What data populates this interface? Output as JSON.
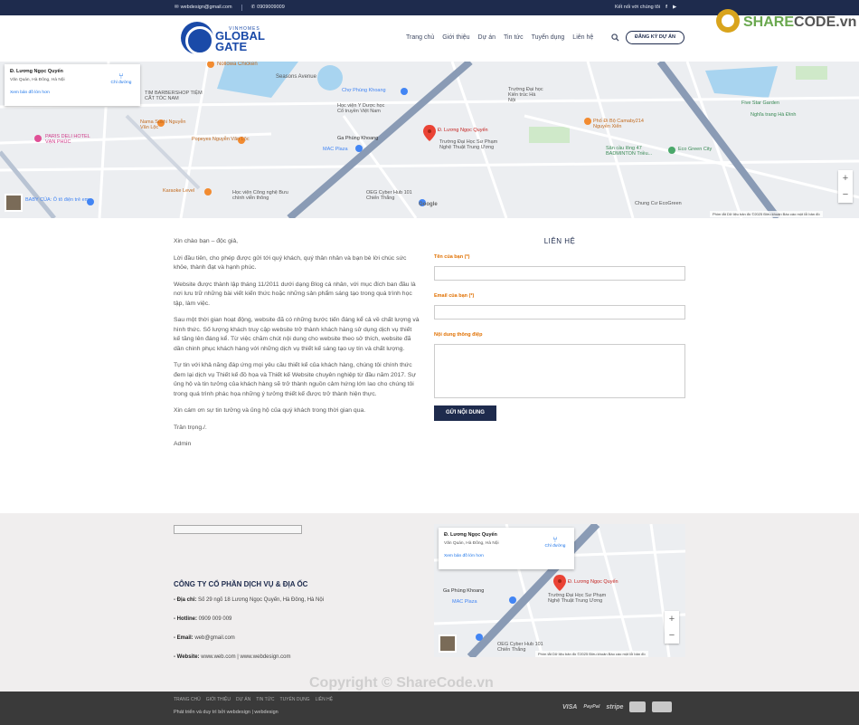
{
  "topbar": {
    "email": "webdesign@gmail.com",
    "phone": "0909009009",
    "social_label": "Kết nối với chúng tôi"
  },
  "logo": {
    "small": "VINHOMES",
    "line1": "GLOBAL",
    "line2": "GATE"
  },
  "nav": {
    "items": [
      "Trang chủ",
      "Giới thiệu",
      "Dự án",
      "Tin tức",
      "Tuyển dụng",
      "Liên hệ"
    ],
    "register_label": "ĐĂNG KÝ DỰ ÁN"
  },
  "map": {
    "place_name": "Đ. Lương Ngọc Quyến",
    "address": "Văn Quán, Hà Đông, Hà Nội",
    "directions": "Chỉ đường",
    "larger_map": "Xem bản đồ lớn hơn",
    "pin_label": "Đ. Lương Ngọc Quyến",
    "zoom_in": "+",
    "zoom_out": "−",
    "footer": "Phím tắt   Dữ liệu bản đồ ©2025   Điều khoản   Báo cáo một lỗi bản đồ",
    "labels": {
      "nollowa": "Nollowa Chicken",
      "seasons": "Seasons Avenue",
      "barber": "TIM BARBERSHOP TIỆM CẮT TÓC NAM",
      "chophung": "Chợ Phùng Khoang",
      "hocvien": "Học viện Y Dược học Cổ truyền Việt Nam",
      "truongdh": "Trường Đại học Kiến trúc Hà Nội",
      "namasushi": "Nama Sushi Nguyễn Văn Lộc",
      "paris": "PARIS DELI HOTEL VẠN PHÚC",
      "popeyes": "Popeyes Nguyễn Văn Lộc",
      "gaphung": "Ga Phùng Khoang",
      "macplaza": "MAC Plaza",
      "spkt": "Trường Đại Học Sư Phạm Nghệ Thuật Trung Ương",
      "pho": "Phố Đi Bộ Camaby214 Nguyễn Xiển",
      "sanbadminton": "Sân cầu lông 47 BADMINTON Triều...",
      "ecogreen": "Eco Green City",
      "fivestar": "Five Star Garden",
      "nghiatrang": "Nghĩa trang Hà Đình",
      "karaoke": "Karaoke Level",
      "hvcn": "Học viện Công nghệ Bưu chính viễn thông",
      "oeg": "OEG Cyber Hub 101 Chiến Thắng",
      "babycua": "BABY CỦA: Ô tô điện trẻ em...",
      "chungcu": "Chung Cư EcoGreen",
      "google": "Google"
    }
  },
  "content": {
    "greeting": "Xin chào bạn – độc giả,",
    "p1": "Lời đầu tiên, cho phép được gửi tới quý khách, quý thân nhân và bạn bè lời chúc sức khỏe, thành đạt và hạnh phúc.",
    "p2": "Website được thành lập tháng 11/2011 dưới dạng Blog cá nhân, với mục đích ban đầu là nơi lưu trữ những bài viết kiến thức hoặc những sản phẩm sáng tạo trong quá trình học tập, làm việc.",
    "p3": "Sau một thời gian hoạt động, website đã có những bước tiến đáng kể cả về chất lượng và hình thức. Số lượng khách truy cập website trở thành khách hàng sử dụng dịch vụ thiết kế tăng lên đáng kể. Từ việc chăm chút nội dung cho website theo sở thích, website đã dần chinh phục khách hàng với những dịch vụ thiết kế sáng tạo uy tín và chất lượng.",
    "p4": "Tự tin với khả năng đáp ứng mọi yêu cầu thiết kế của khách hàng, chúng tôi chính thức đem lại dịch vụ Thiết kế đồ họa và Thiết kế Website chuyên nghiệp từ đầu năm 2017. Sự ủng hộ và tin tưởng của khách hàng sẽ trở thành nguồn cảm hứng lớn lao cho chúng tôi trong quá trình phác họa những ý tưởng thiết kế được trở thành hiện thực.",
    "p5": "Xin cám ơn sự tin tưởng và ủng hộ của quý khách trong thời gian qua.",
    "p6": "Trân trọng./.",
    "p7": "Admin"
  },
  "contact": {
    "title": "LIÊN HỆ",
    "name_label": "Tên của bạn (*)",
    "email_label": "Email của bạn (*)",
    "message_label": "Nội dung thông điệp",
    "submit": "GỬI NỘI DUNG"
  },
  "footer": {
    "company": "CÔNG TY CỔ PHẦN DỊCH VỤ & ĐỊA ỐC",
    "address_label": "- Địa chỉ:",
    "address": "Số 29 ngõ 18 Lương Ngọc Quyến, Hà Đông, Hà Nội",
    "hotline_label": "- Hotline:",
    "hotline": "0909 009 009",
    "email_label": "- Email:",
    "email": "web@gmail.com",
    "website_label": "- Website:",
    "website": "www.web.com | www.webdesign.com"
  },
  "bottom": {
    "links": [
      "TRANG CHỦ",
      "GIỚI THIỆU",
      "DỰ ÁN",
      "TIN TỨC",
      "TUYỂN DỤNG",
      "LIÊN HỆ"
    ],
    "credit": "Phát triển và duy trì bởi webdesign | webdesign",
    "payments": [
      "VISA",
      "PayPal",
      "stripe"
    ]
  },
  "watermark": {
    "top_brand_1": "SHARE",
    "top_brand_2": "CODE.vn",
    "bottom": "Copyright © ShareCode.vn"
  },
  "colors": {
    "navy": "#1e2b4d",
    "orange": "#e07000",
    "blue": "#1a4aa8"
  }
}
